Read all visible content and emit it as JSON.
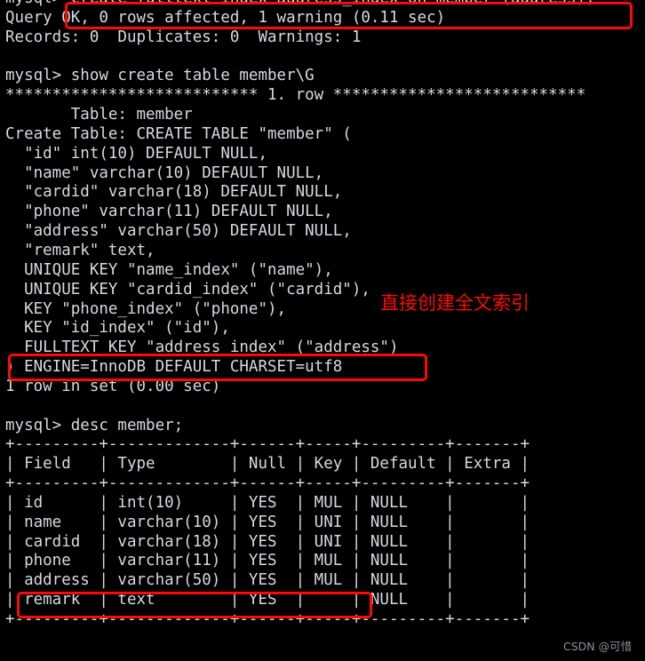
{
  "terminal": {
    "prompt": "mysql>",
    "foreground_color": "#d6d9e0",
    "background_color": "#000000",
    "lines": [
      "mysql> create fulltext index address_index on member (address);",
      "Query OK, 0 rows affected, 1 warning (0.11 sec)",
      "Records: 0  Duplicates: 0  Warnings: 1",
      "",
      "mysql> show create table member\\G",
      "*************************** 1. row ***************************",
      "       Table: member",
      "Create Table: CREATE TABLE \"member\" (",
      "  \"id\" int(10) DEFAULT NULL,",
      "  \"name\" varchar(10) DEFAULT NULL,",
      "  \"cardid\" varchar(18) DEFAULT NULL,",
      "  \"phone\" varchar(11) DEFAULT NULL,",
      "  \"address\" varchar(50) DEFAULT NULL,",
      "  \"remark\" text,",
      "  UNIQUE KEY \"name_index\" (\"name\"),",
      "  UNIQUE KEY \"cardid_index\" (\"cardid\"),",
      "  KEY \"phone_index\" (\"phone\"),",
      "  KEY \"id_index\" (\"id\"),",
      "  FULLTEXT KEY \"address_index\" (\"address\")",
      ") ENGINE=InnoDB DEFAULT CHARSET=utf8",
      "1 row in set (0.00 sec)",
      "",
      "mysql> desc member;",
      "+---------+-------------+------+-----+---------+-------+",
      "| Field   | Type        | Null | Key | Default | Extra |",
      "+---------+-------------+------+-----+---------+-------+",
      "| id      | int(10)     | YES  | MUL | NULL    |       |",
      "| name    | varchar(10) | YES  | UNI | NULL    |       |",
      "| cardid  | varchar(18) | YES  | UNI | NULL    |       |",
      "| phone   | varchar(11) | YES  | MUL | NULL    |       |",
      "| address | varchar(50) | YES  | MUL | NULL    |       |",
      "| remark  | text        | YES  |     | NULL    |       |",
      "+---------+-------------+------+-----+---------+-------+"
    ],
    "commands": [
      "create fulltext index address_index on member (address);",
      "show create table member\\G",
      "desc member;"
    ],
    "status_messages": [
      "Query OK, 0 rows affected, 1 warning (0.11 sec)",
      "Records: 0  Duplicates: 0  Warnings: 1",
      "1 row in set (0.00 sec)"
    ]
  },
  "desc_table": {
    "headers": [
      "Field",
      "Type",
      "Null",
      "Key",
      "Default",
      "Extra"
    ],
    "rows": [
      [
        "id",
        "int(10)",
        "YES",
        "MUL",
        "NULL",
        ""
      ],
      [
        "name",
        "varchar(10)",
        "YES",
        "UNI",
        "NULL",
        ""
      ],
      [
        "cardid",
        "varchar(18)",
        "YES",
        "UNI",
        "NULL",
        ""
      ],
      [
        "phone",
        "varchar(11)",
        "YES",
        "MUL",
        "NULL",
        ""
      ],
      [
        "address",
        "varchar(50)",
        "YES",
        "MUL",
        "NULL",
        ""
      ],
      [
        "remark",
        "text",
        "YES",
        "",
        "NULL",
        ""
      ]
    ]
  },
  "annotations": {
    "color": "#fb0b08",
    "note_cn": "直接创建全文索引",
    "highlight_labels": [
      "create-fulltext-index-command",
      "fulltext-key-definition",
      "address-row-mul-key"
    ]
  },
  "watermark": {
    "text": "CSDN @可惜",
    "color": "#8d9099"
  }
}
